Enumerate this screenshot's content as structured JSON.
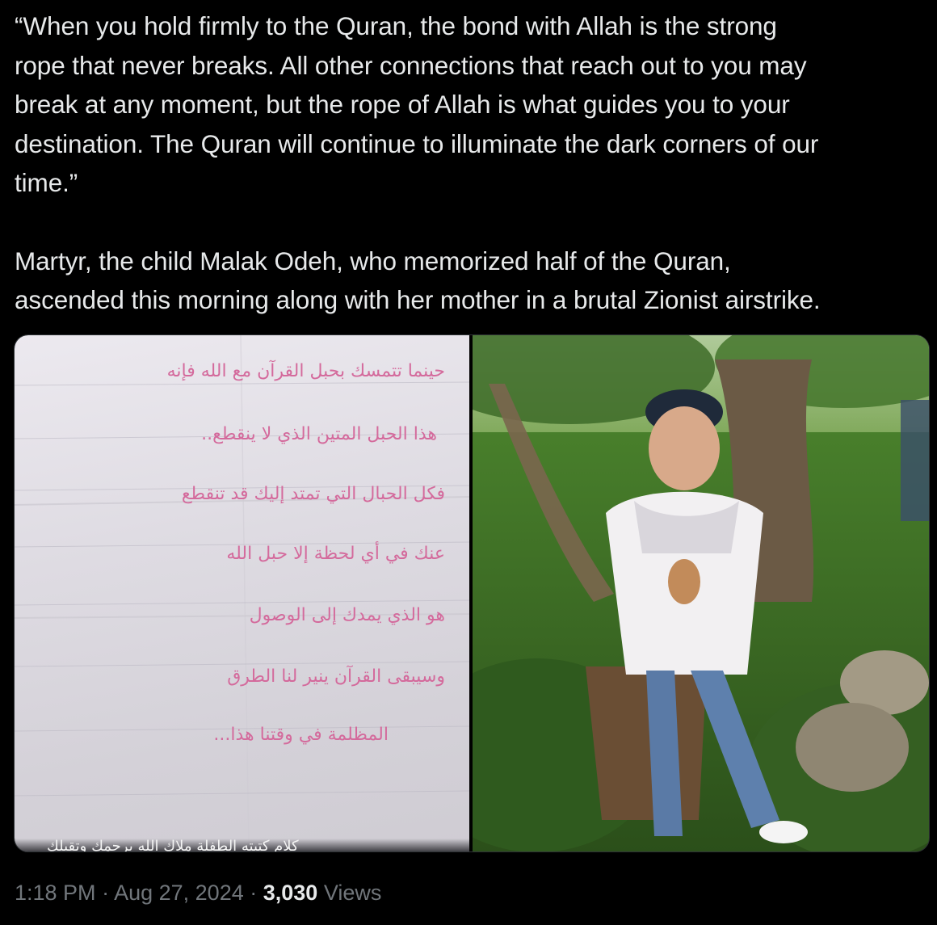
{
  "tweet": {
    "quote_paragraph": "“When you hold firmly to the Quran, the bond with Allah is the strong rope that never breaks. All other connections that reach out to you may break at any moment, but the rope of Allah is what guides you to your destination. The Quran will continue to illuminate the dark corners of our time.”",
    "paragraph_lines": [
      "“When you hold firmly to the Quran, the bond with Allah is the strong",
      "rope that never breaks. All other connections that reach out to you may",
      "break at any moment, but the rope of Allah is what guides you to your",
      "destination. The Quran will continue to illuminate the dark corners of our",
      "time.”"
    ],
    "second_paragraph_lines": [
      "Martyr, the child Malak Odeh, who memorized half of the Quran,",
      "ascended this morning along with her mother in a brutal Zionist airstrike."
    ]
  },
  "media": {
    "handwritten_lines": [
      "حينما تتمسك بحبل القرآن مع الله فإنه",
      "هذا الحبل المتين الذي لا ينقطع..",
      "فكل الحبال التي تمتد إليك قد تنقطع",
      "عنك في أي لحظة إلا حبل الله",
      "هو الذي يمدك إلى الوصول",
      "وسيبقى القرآن ينير لنا الطرق",
      "المظلمة في وقتنا هذا..."
    ],
    "caption_overlay": "كلام كتبته الطفلة ملاك الله يرحمك وتقبلك"
  },
  "meta": {
    "time": "1:18 PM",
    "separator1": " · ",
    "date": "Aug 27, 2024",
    "separator2": " · ",
    "views_count": "3,030",
    "views_label": " Views"
  },
  "colors": {
    "background": "#000000",
    "text_primary": "#e7e9ea",
    "text_secondary": "#71767b",
    "ink": "#d46a9c",
    "border": "#2f3336"
  }
}
